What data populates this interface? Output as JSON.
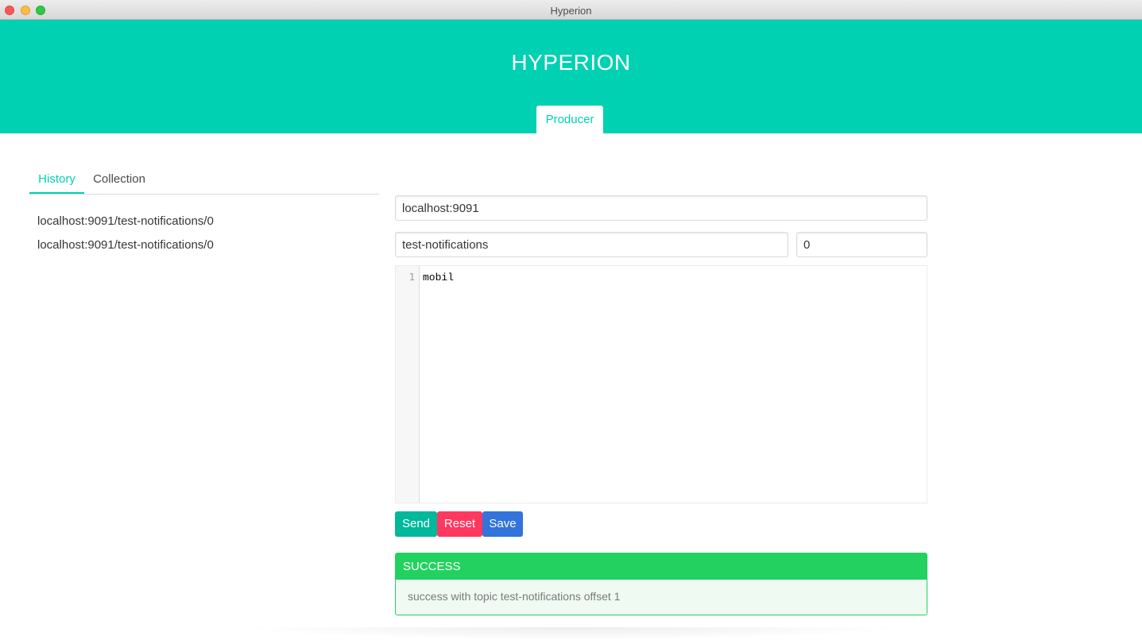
{
  "window": {
    "title": "Hyperion"
  },
  "header": {
    "brand": "HYPERION",
    "tab": "Producer"
  },
  "sidebar": {
    "tabs": [
      {
        "label": "History",
        "active": true
      },
      {
        "label": "Collection",
        "active": false
      }
    ],
    "history": [
      {
        "label": "localhost:9091/test-notifications/0"
      },
      {
        "label": "localhost:9091/test-notifications/0"
      }
    ]
  },
  "form": {
    "host": "localhost:9091",
    "topic": "test-notifications",
    "partition": "0",
    "editor": {
      "line_number": "1",
      "content": "mobil"
    }
  },
  "actions": {
    "send": "Send",
    "reset": "Reset",
    "save": "Save"
  },
  "result": {
    "status": "SUCCESS",
    "message": "success with topic test-notifications offset 1"
  },
  "colors": {
    "primary": "#00d1b2",
    "send": "#00b89c",
    "reset": "#ff3860",
    "save": "#3273dc",
    "success": "#23d160"
  }
}
